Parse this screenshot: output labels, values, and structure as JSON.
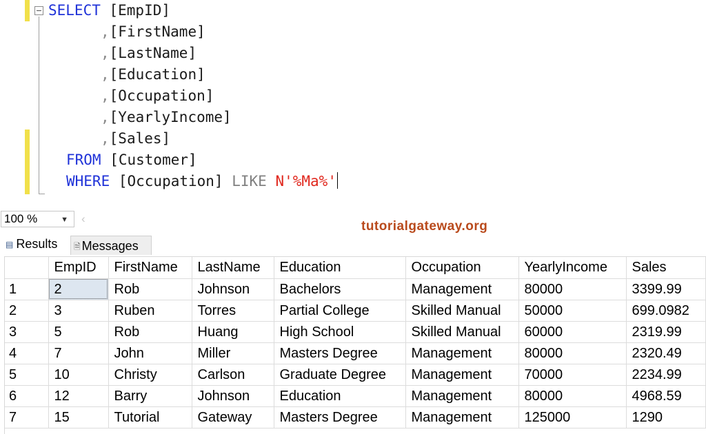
{
  "editor": {
    "lines": [
      [
        {
          "t": "SELECT",
          "c": "kw"
        },
        {
          "t": " [EmpID]",
          "c": ""
        }
      ],
      [
        {
          "t": ",",
          "c": "punct"
        },
        {
          "t": "[FirstName]",
          "c": ""
        }
      ],
      [
        {
          "t": ",",
          "c": "punct"
        },
        {
          "t": "[LastName]",
          "c": ""
        }
      ],
      [
        {
          "t": ",",
          "c": "punct"
        },
        {
          "t": "[Education]",
          "c": ""
        }
      ],
      [
        {
          "t": ",",
          "c": "punct"
        },
        {
          "t": "[Occupation]",
          "c": ""
        }
      ],
      [
        {
          "t": ",",
          "c": "punct"
        },
        {
          "t": "[YearlyIncome]",
          "c": ""
        }
      ],
      [
        {
          "t": ",",
          "c": "punct"
        },
        {
          "t": "[Sales]",
          "c": ""
        }
      ],
      [
        {
          "t": "FROM",
          "c": "kw"
        },
        {
          "t": " [Customer]",
          "c": ""
        }
      ],
      [
        {
          "t": "WHERE",
          "c": "kw"
        },
        {
          "t": " [Occupation] ",
          "c": ""
        },
        {
          "t": "LIKE",
          "c": "gray"
        },
        {
          "t": " ",
          "c": ""
        },
        {
          "t": "N'%Ma%'",
          "c": "str"
        }
      ]
    ]
  },
  "zoom": {
    "value": "100 %"
  },
  "watermark": "tutorialgateway.org",
  "tabs": {
    "results": "Results",
    "messages": "Messages"
  },
  "grid": {
    "columns": [
      "",
      "EmpID",
      "FirstName",
      "LastName",
      "Education",
      "Occupation",
      "YearlyIncome",
      "Sales"
    ],
    "rows": [
      [
        "1",
        "2",
        "Rob",
        "Johnson",
        "Bachelors",
        "Management",
        "80000",
        "3399.99"
      ],
      [
        "2",
        "3",
        "Ruben",
        "Torres",
        "Partial College",
        "Skilled Manual",
        "50000",
        "699.0982"
      ],
      [
        "3",
        "5",
        "Rob",
        "Huang",
        "High School",
        "Skilled Manual",
        "60000",
        "2319.99"
      ],
      [
        "4",
        "7",
        "John",
        "Miller",
        "Masters Degree",
        "Management",
        "80000",
        "2320.49"
      ],
      [
        "5",
        "10",
        "Christy",
        "Carlson",
        "Graduate Degree",
        "Management",
        "70000",
        "2234.99"
      ],
      [
        "6",
        "12",
        "Barry",
        "Johnson",
        "Education",
        "Management",
        "80000",
        "4968.59"
      ],
      [
        "7",
        "15",
        "Tutorial",
        "Gateway",
        "Masters Degree",
        "Management",
        "125000",
        "1290"
      ]
    ]
  },
  "colors": {
    "keyword": "#1f32d8",
    "string": "#e0281e",
    "gutter_mark": "#f1e04a",
    "watermark": "#b94a1c"
  }
}
